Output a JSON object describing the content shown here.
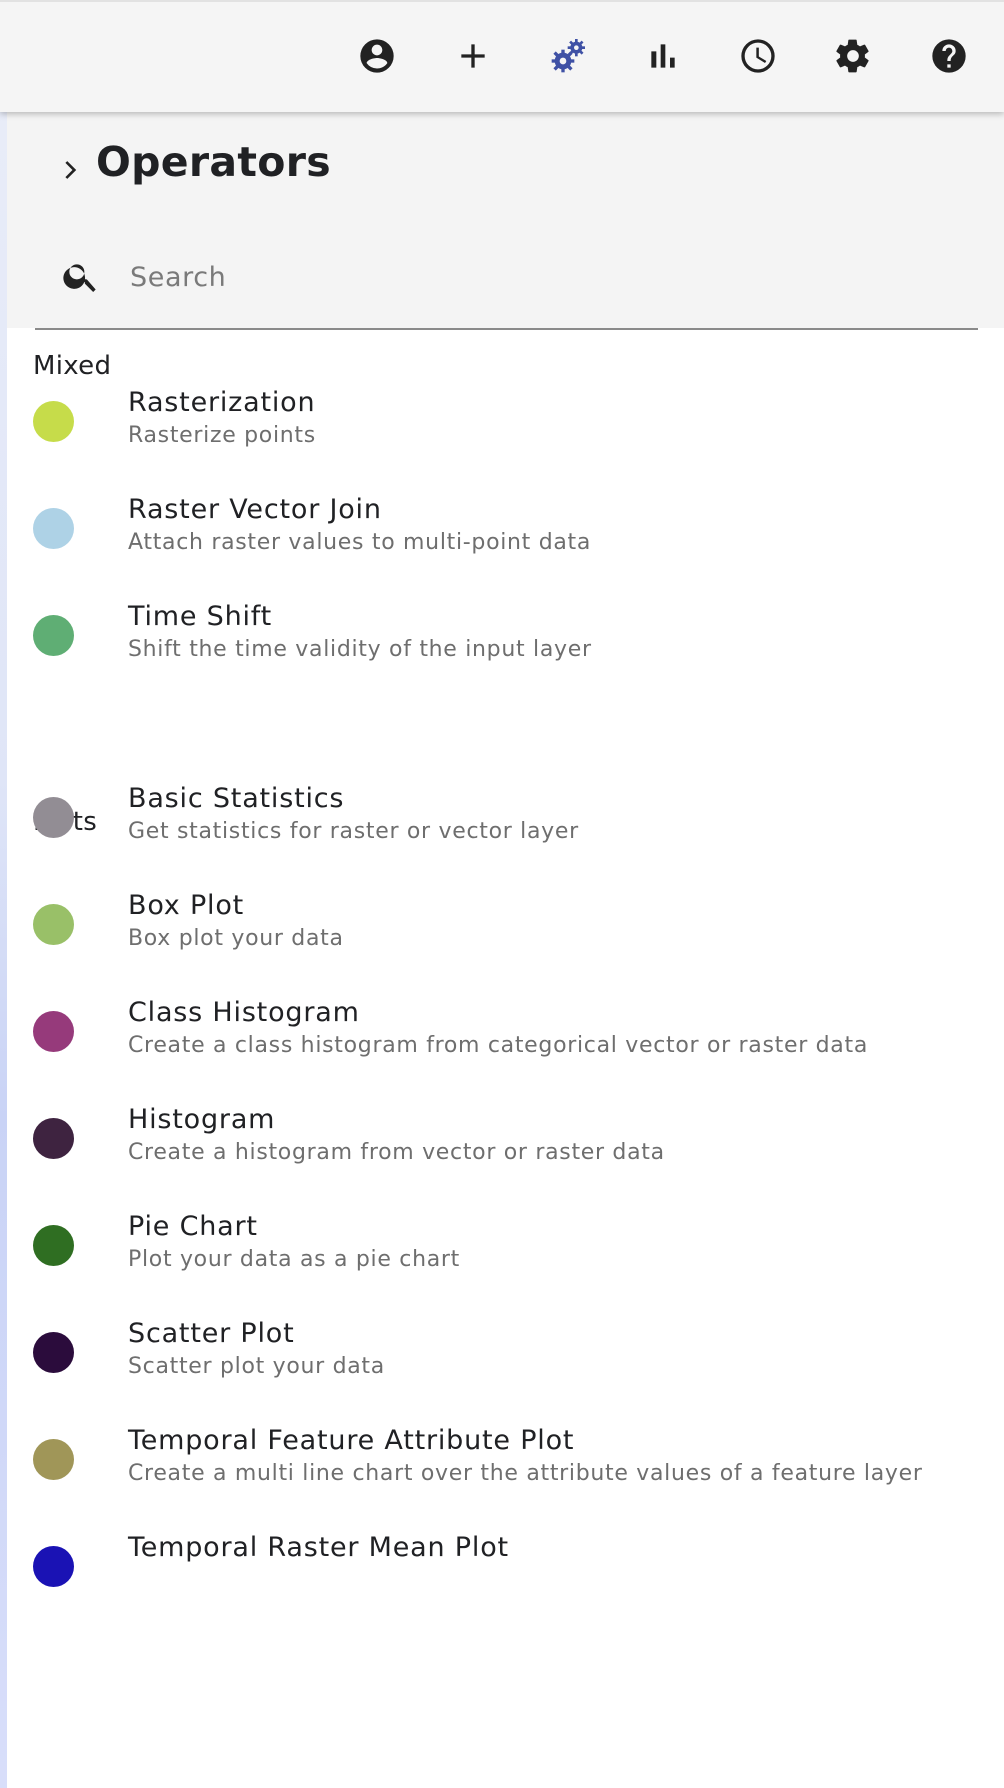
{
  "toolbar": {
    "buttons": [
      {
        "icon": "account-circle-icon",
        "active": false
      },
      {
        "icon": "add-icon",
        "active": false
      },
      {
        "icon": "operators-gears-icon",
        "active": true
      },
      {
        "icon": "bar-chart-icon",
        "active": false
      },
      {
        "icon": "clock-icon",
        "active": false
      },
      {
        "icon": "settings-icon",
        "active": false
      },
      {
        "icon": "help-icon",
        "active": false
      }
    ],
    "active_color": "#3f51a5",
    "icon_color": "#222222"
  },
  "panel": {
    "title": "Operators",
    "search": {
      "placeholder": "Search",
      "value": ""
    }
  },
  "sections": [
    {
      "title": "Mixed",
      "items": [
        {
          "name": "Rasterization",
          "description": "Rasterize points",
          "color": "#c6dc4a"
        },
        {
          "name": "Raster Vector Join",
          "description": "Attach raster values to multi-point data",
          "color": "#aed2e6"
        },
        {
          "name": "Time Shift",
          "description": "Shift the time validity of the input layer",
          "color": "#5fae74"
        }
      ]
    },
    {
      "title": "Plots",
      "items": [
        {
          "name": "Basic Statistics",
          "description": "Get statistics for raster or vector layer",
          "color": "#928d94"
        },
        {
          "name": "Box Plot",
          "description": "Box plot your data",
          "color": "#99c068"
        },
        {
          "name": "Class Histogram",
          "description": "Create a class histogram from categorical vector or raster data",
          "color": "#963a7b"
        },
        {
          "name": "Histogram",
          "description": "Create a histogram from vector or raster data",
          "color": "#3e2340"
        },
        {
          "name": "Pie Chart",
          "description": "Plot your data as a pie chart",
          "color": "#2f6e22"
        },
        {
          "name": "Scatter Plot",
          "description": "Scatter plot your data",
          "color": "#2b0c3c"
        },
        {
          "name": "Temporal Feature Attribute Plot",
          "description": "Create a multi line chart over the attribute values of a feature layer",
          "color": "#a09658"
        },
        {
          "name": "Temporal Raster Mean Plot",
          "description": "",
          "color": "#1a12b4"
        }
      ]
    }
  ]
}
